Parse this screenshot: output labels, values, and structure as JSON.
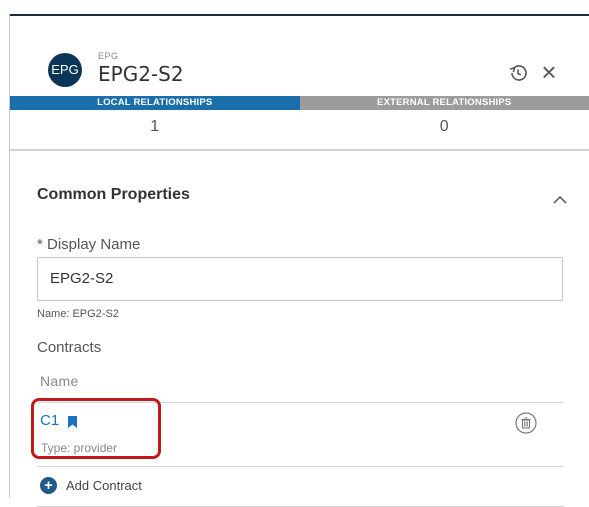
{
  "header": {
    "badge_text": "EPG",
    "kind_label": "EPG",
    "title": "EPG2-S2",
    "history_icon": "history-icon",
    "close_icon": "close-icon",
    "close_glyph": "×"
  },
  "tabs": [
    {
      "label": "LOCAL RELATIONSHIPS",
      "count": "1",
      "active": true
    },
    {
      "label": "EXTERNAL RELATIONSHIPS",
      "count": "0",
      "active": false
    }
  ],
  "section": {
    "title": "Common Properties",
    "collapse_icon": "chevron-up-icon",
    "display_name_label": "* Display Name",
    "display_name_value": "EPG2-S2",
    "name_hint": "Name: EPG2-S2",
    "contracts_label": "Contracts",
    "contracts_column": "Name"
  },
  "contracts": [
    {
      "name": "C1",
      "icon": "bookmark-icon",
      "type": "Type: provider",
      "delete_icon": "trash-icon"
    }
  ],
  "add_contract": {
    "label": "Add Contract",
    "icon": "plus-circle-icon",
    "plus_glyph": "+"
  },
  "colors": {
    "accent": "#1a6fab",
    "badge": "#0c3658",
    "link": "#1a73c2",
    "highlight": "#c0191b",
    "inactive_tab": "#9c9c9c"
  }
}
